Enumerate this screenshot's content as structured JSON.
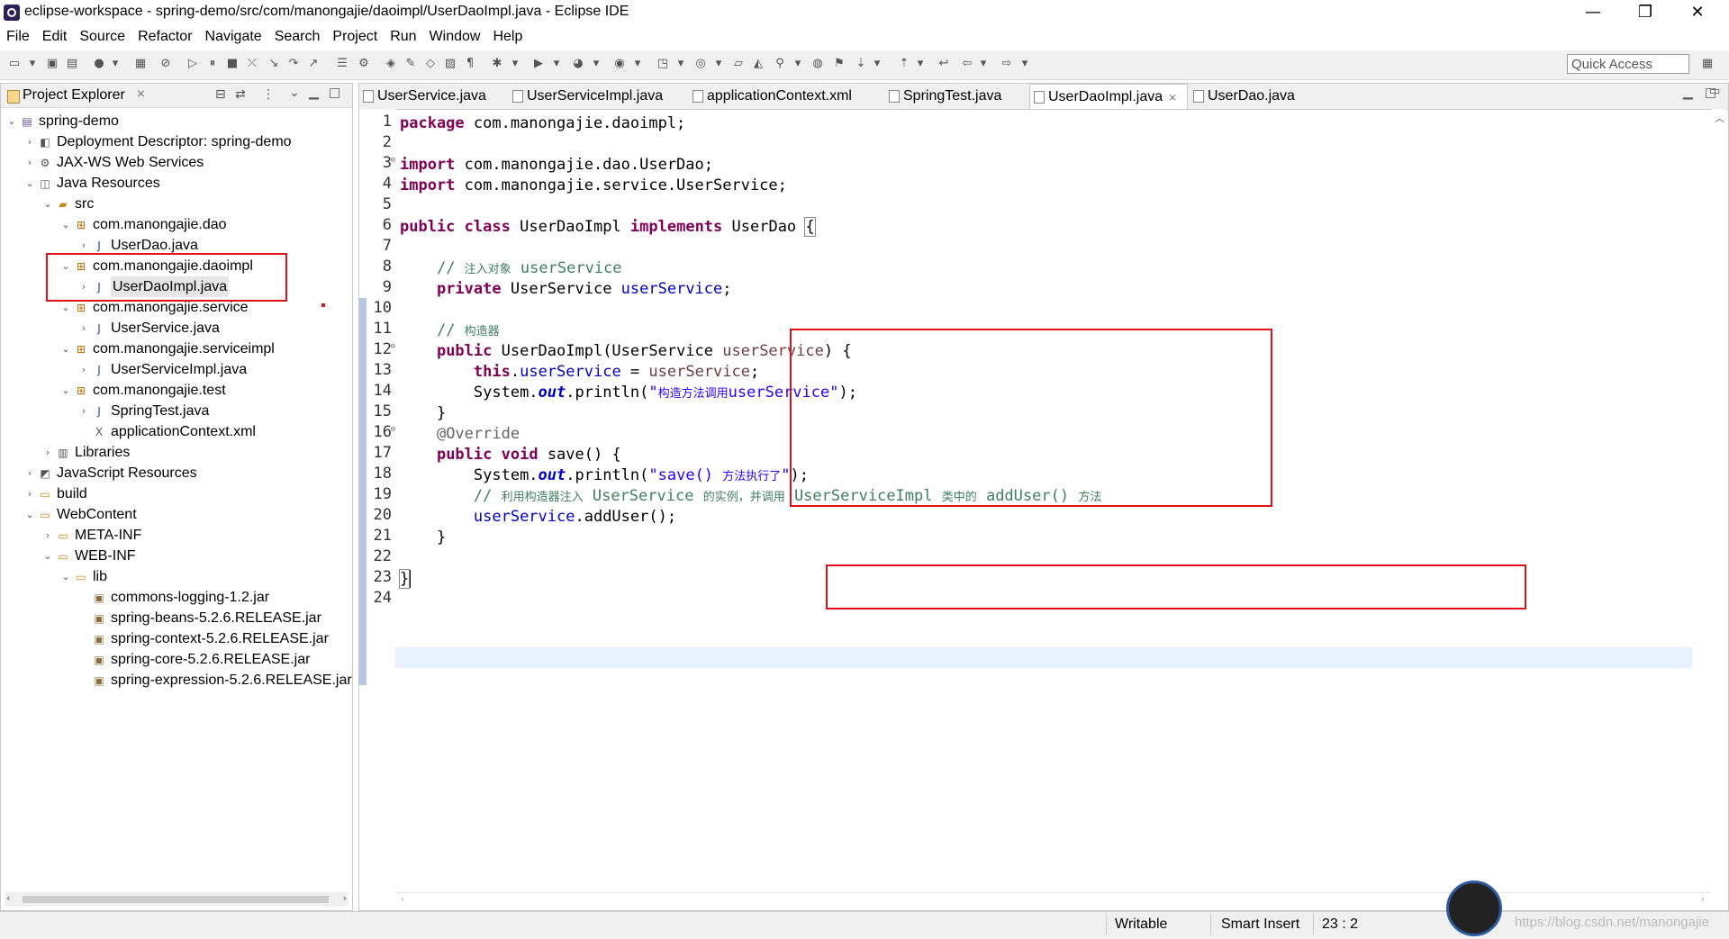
{
  "window": {
    "title": "eclipse-workspace - spring-demo/src/com/manongajie/daoimpl/UserDaoImpl.java - Eclipse IDE",
    "minimize": "—",
    "restore": "❐",
    "close": "✕"
  },
  "menu": [
    "File",
    "Edit",
    "Source",
    "Refactor",
    "Navigate",
    "Search",
    "Project",
    "Run",
    "Window",
    "Help"
  ],
  "toolbar": {
    "quick_access": "Quick Access"
  },
  "explorer": {
    "title": "Project Explorer",
    "tree": [
      {
        "label": "spring-demo",
        "icon": "project-icon",
        "twisty": "⌄"
      },
      {
        "label": "Deployment Descriptor: spring-demo",
        "icon": "deployment-icon",
        "twisty": "›"
      },
      {
        "label": "JAX-WS Web Services",
        "icon": "webservice-icon",
        "twisty": "›"
      },
      {
        "label": "Java Resources",
        "icon": "java-resources-icon",
        "twisty": "⌄"
      },
      {
        "label": "src",
        "icon": "source-folder-icon",
        "twisty": "⌄"
      },
      {
        "label": "com.manongajie.dao",
        "icon": "package-icon",
        "twisty": "⌄"
      },
      {
        "label": "UserDao.java",
        "icon": "java-file-icon",
        "twisty": "›"
      },
      {
        "label": "com.manongajie.daoimpl",
        "icon": "package-icon",
        "twisty": "⌄"
      },
      {
        "label": "UserDaoImpl.java",
        "icon": "java-file-icon",
        "twisty": "›"
      },
      {
        "label": "com.manongajie.service",
        "icon": "package-icon",
        "twisty": "⌄"
      },
      {
        "label": "UserService.java",
        "icon": "java-file-icon",
        "twisty": "›"
      },
      {
        "label": "com.manongajie.serviceimpl",
        "icon": "package-icon",
        "twisty": "⌄"
      },
      {
        "label": "UserServiceImpl.java",
        "icon": "java-file-icon",
        "twisty": "›"
      },
      {
        "label": "com.manongajie.test",
        "icon": "package-icon",
        "twisty": "⌄"
      },
      {
        "label": "SpringTest.java",
        "icon": "java-file-icon",
        "twisty": "›"
      },
      {
        "label": "applicationContext.xml",
        "icon": "xml-file-icon",
        "twisty": ""
      },
      {
        "label": "Libraries",
        "icon": "libraries-icon",
        "twisty": "›"
      },
      {
        "label": "JavaScript Resources",
        "icon": "js-resources-icon",
        "twisty": "›"
      },
      {
        "label": "build",
        "icon": "folder-icon",
        "twisty": "›"
      },
      {
        "label": "WebContent",
        "icon": "folder-icon",
        "twisty": "⌄"
      },
      {
        "label": "META-INF",
        "icon": "folder-icon",
        "twisty": "›"
      },
      {
        "label": "WEB-INF",
        "icon": "folder-icon",
        "twisty": "⌄"
      },
      {
        "label": "lib",
        "icon": "folder-icon",
        "twisty": "⌄"
      },
      {
        "label": "commons-logging-1.2.jar",
        "icon": "jar-icon",
        "twisty": ""
      },
      {
        "label": "spring-beans-5.2.6.RELEASE.jar",
        "icon": "jar-icon",
        "twisty": ""
      },
      {
        "label": "spring-context-5.2.6.RELEASE.jar",
        "icon": "jar-icon",
        "twisty": ""
      },
      {
        "label": "spring-core-5.2.6.RELEASE.jar",
        "icon": "jar-icon",
        "twisty": ""
      },
      {
        "label": "spring-expression-5.2.6.RELEASE.jar",
        "icon": "jar-icon",
        "twisty": ""
      }
    ]
  },
  "editor": {
    "tabs": [
      {
        "label": "UserService.java",
        "active": false
      },
      {
        "label": "UserServiceImpl.java",
        "active": false
      },
      {
        "label": "applicationContext.xml",
        "active": false
      },
      {
        "label": "SpringTest.java",
        "active": false
      },
      {
        "label": "UserDaoImpl.java",
        "active": true
      },
      {
        "label": "UserDao.java",
        "active": false
      }
    ],
    "line_numbers": [
      "1",
      "2",
      "3",
      "4",
      "5",
      "6",
      "7",
      "8",
      "9",
      "10",
      "11",
      "12",
      "13",
      "14",
      "15",
      "16",
      "17",
      "18",
      "19",
      "20",
      "21",
      "22",
      "23",
      "24"
    ],
    "fold_markers": {
      "3": "⊖",
      "12": "⊖",
      "16": "⊖"
    },
    "code": {
      "l1_kw": "package",
      "l1_rest": " com.manongajie.daoimpl;",
      "l3_kw": "import",
      "l3_rest": " com.manongajie.dao.UserDao;",
      "l4_kw": "import",
      "l4_rest": " com.manongajie.service.UserService;",
      "l6_kw1": "public",
      "l6_kw2": "class",
      "l6_name": " UserDaoImpl ",
      "l6_kw3": "implements",
      "l6_rest": " UserDao ",
      "l6_brace": "{",
      "l8_cm": "// ",
      "l8_cjk": "注入对象",
      "l8_cm2": " userService",
      "l9_kw": "private",
      "l9_type": " UserService ",
      "l9_fld": "userService",
      "l9_semi": ";",
      "l11_cm": "// ",
      "l11_cjk": "构造器",
      "l12_kw": "public",
      "l12_mid": " UserDaoImpl(UserService ",
      "l12_prm": "userService",
      "l12_end": ") {",
      "l13_kw": "this",
      "l13_dot": ".",
      "l13_fld": "userService",
      "l13_eq": " = ",
      "l13_prm": "userService",
      "l13_semi": ";",
      "l14_a": "System.",
      "l14_out": "out",
      "l14_b": ".println(",
      "l14_q": "\"",
      "l14_cjk": "构造方法调用",
      "l14_st": "userService\"",
      "l14_end": ");",
      "l15": "}",
      "l16_an": "@Override",
      "l17_kw1": "public",
      "l17_kw2": "void",
      "l17_rest": " save() {",
      "l18_a": "System.",
      "l18_out": "out",
      "l18_b": ".println(",
      "l18_st1": "\"save() ",
      "l18_cjk": "方法执行了",
      "l18_st2": "\"",
      "l18_end": ");",
      "l19_cm1": "// ",
      "l19_cjk1": "利用构造器注入",
      "l19_cm2": " UserService ",
      "l19_cjk2": "的实例，并调用",
      "l19_cm3": " UserServiceImpl ",
      "l19_cjk3": "类中的",
      "l19_cm4": " addUser() ",
      "l19_cjk4": "方法",
      "l20_fld": "userService",
      "l20_rest": ".addUser();",
      "l21": "}",
      "l23": "}"
    }
  },
  "status": {
    "writable": "Writable",
    "insert_mode": "Smart Insert",
    "position": "23 : 2"
  },
  "watermark": "https://blog.csdn.net/manongajie",
  "colors": {
    "keyword": "#7f0055",
    "field": "#0000c0",
    "comment": "#3f7f5f",
    "string": "#2a00ff",
    "highlight_box": "#e0111a",
    "current_line": "#e8f2fe"
  }
}
